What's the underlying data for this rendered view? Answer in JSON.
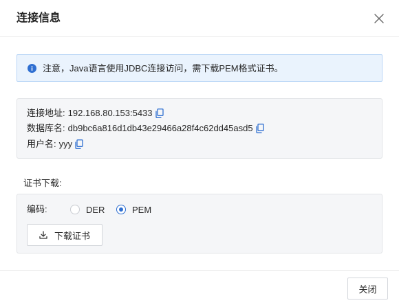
{
  "dialog": {
    "title": "连接信息"
  },
  "notice": {
    "text": "注意，Java语言使用JDBC连接访问，需下载PEM格式证书。",
    "icon": "info-icon"
  },
  "connection": {
    "address_label": "连接地址: ",
    "address_value": "192.168.80.153:5433",
    "database_label": "数据库名: ",
    "database_value": "db9bc6a816d1db43e29466a28f4c62dd45asd5",
    "user_label": "用户名: ",
    "user_value": "yyy"
  },
  "certificate": {
    "section_label": "证书下载:",
    "encoding_label": "编码:",
    "options": [
      "DER",
      "PEM"
    ],
    "selected": "PEM",
    "download_label": "下载证书"
  },
  "footer": {
    "close_label": "关闭"
  },
  "colors": {
    "accent": "#2f6fd1",
    "info_bg": "#eaf3fd",
    "info_border": "#b6d4f6",
    "panel_bg": "#f5f6f8"
  }
}
